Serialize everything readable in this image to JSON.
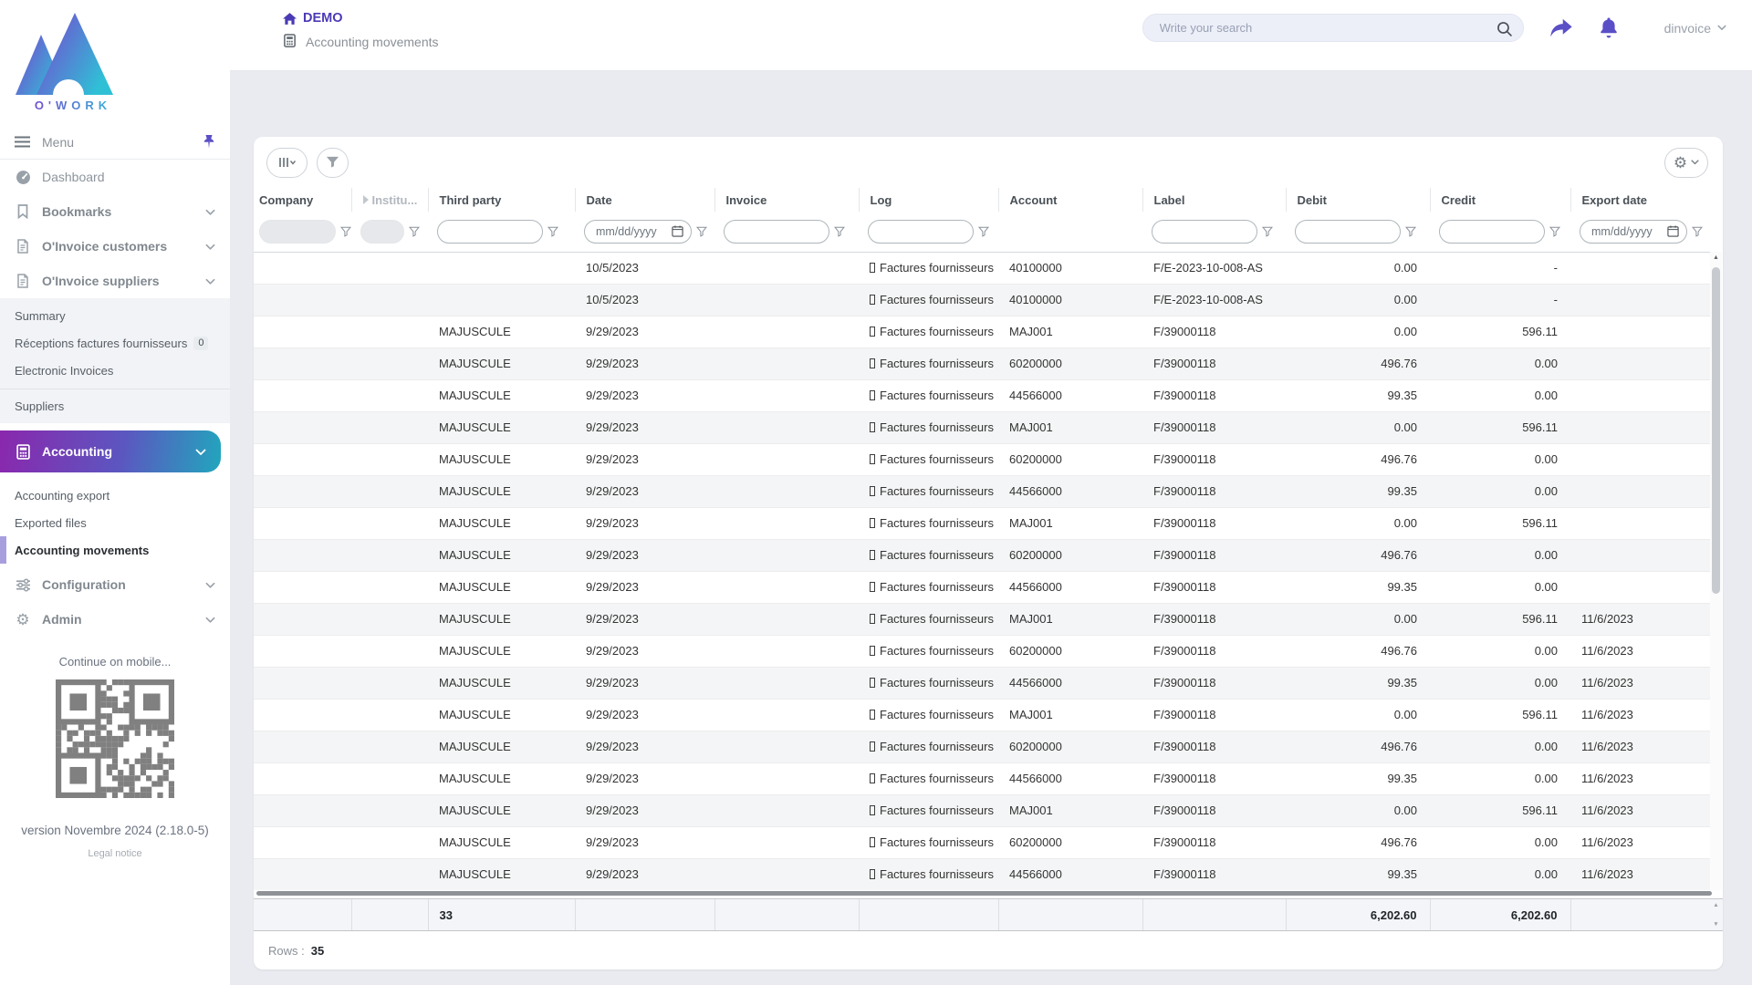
{
  "brand": {
    "wordmark": "O'WORK"
  },
  "header": {
    "breadcrumb_home": "DEMO",
    "breadcrumb_page": "Accounting movements",
    "search_placeholder": "Write your search",
    "username": "dinvoice"
  },
  "sidebar": {
    "menu_label": "Menu",
    "items": [
      {
        "label": "Dashboard"
      },
      {
        "label": "Bookmarks"
      },
      {
        "label": "O'Invoice customers"
      },
      {
        "label": "O'Invoice suppliers"
      },
      {
        "label": "Accounting"
      },
      {
        "label": "Configuration"
      },
      {
        "label": "Admin"
      }
    ],
    "suppliers_submenu": {
      "summary": "Summary",
      "receptions": "Réceptions factures fournisseurs",
      "receptions_badge": "0",
      "electronic_invoices": "Electronic Invoices",
      "suppliers": "Suppliers"
    },
    "accounting_submenu": {
      "accounting_export": "Accounting export",
      "exported_files": "Exported files",
      "accounting_movements": "Accounting movements"
    },
    "mobile_hint": "Continue on mobile...",
    "version": "version Novembre 2024 (2.18.0-5)",
    "legal_notice": "Legal notice"
  },
  "table": {
    "columns": [
      "Company",
      "Institu...",
      "Third party",
      "Date",
      "Invoice",
      "Log",
      "Account",
      "Label",
      "Debit",
      "Credit",
      "Export date"
    ],
    "date_placeholder": "mm/dd/yyyy",
    "rows": [
      {
        "company": "",
        "institution": "",
        "third_party": "",
        "date": "10/5/2023",
        "invoice": "",
        "log": "Factures fournisseurs",
        "account": "40100000",
        "label": "F/E-2023-10-008-AS",
        "debit": "0.00",
        "credit": "-",
        "export_date": ""
      },
      {
        "company": "",
        "institution": "",
        "third_party": "",
        "date": "10/5/2023",
        "invoice": "",
        "log": "Factures fournisseurs",
        "account": "40100000",
        "label": "F/E-2023-10-008-AS",
        "debit": "0.00",
        "credit": "-",
        "export_date": ""
      },
      {
        "company": "",
        "institution": "",
        "third_party": "MAJUSCULE",
        "date": "9/29/2023",
        "invoice": "",
        "log": "Factures fournisseurs",
        "account": "MAJ001",
        "label": "F/39000118",
        "debit": "0.00",
        "credit": "596.11",
        "export_date": ""
      },
      {
        "company": "",
        "institution": "",
        "third_party": "MAJUSCULE",
        "date": "9/29/2023",
        "invoice": "",
        "log": "Factures fournisseurs",
        "account": "60200000",
        "label": "F/39000118",
        "debit": "496.76",
        "credit": "0.00",
        "export_date": ""
      },
      {
        "company": "",
        "institution": "",
        "third_party": "MAJUSCULE",
        "date": "9/29/2023",
        "invoice": "",
        "log": "Factures fournisseurs",
        "account": "44566000",
        "label": "F/39000118",
        "debit": "99.35",
        "credit": "0.00",
        "export_date": ""
      },
      {
        "company": "",
        "institution": "",
        "third_party": "MAJUSCULE",
        "date": "9/29/2023",
        "invoice": "",
        "log": "Factures fournisseurs",
        "account": "MAJ001",
        "label": "F/39000118",
        "debit": "0.00",
        "credit": "596.11",
        "export_date": ""
      },
      {
        "company": "",
        "institution": "",
        "third_party": "MAJUSCULE",
        "date": "9/29/2023",
        "invoice": "",
        "log": "Factures fournisseurs",
        "account": "60200000",
        "label": "F/39000118",
        "debit": "496.76",
        "credit": "0.00",
        "export_date": ""
      },
      {
        "company": "",
        "institution": "",
        "third_party": "MAJUSCULE",
        "date": "9/29/2023",
        "invoice": "",
        "log": "Factures fournisseurs",
        "account": "44566000",
        "label": "F/39000118",
        "debit": "99.35",
        "credit": "0.00",
        "export_date": ""
      },
      {
        "company": "",
        "institution": "",
        "third_party": "MAJUSCULE",
        "date": "9/29/2023",
        "invoice": "",
        "log": "Factures fournisseurs",
        "account": "MAJ001",
        "label": "F/39000118",
        "debit": "0.00",
        "credit": "596.11",
        "export_date": ""
      },
      {
        "company": "",
        "institution": "",
        "third_party": "MAJUSCULE",
        "date": "9/29/2023",
        "invoice": "",
        "log": "Factures fournisseurs",
        "account": "60200000",
        "label": "F/39000118",
        "debit": "496.76",
        "credit": "0.00",
        "export_date": ""
      },
      {
        "company": "",
        "institution": "",
        "third_party": "MAJUSCULE",
        "date": "9/29/2023",
        "invoice": "",
        "log": "Factures fournisseurs",
        "account": "44566000",
        "label": "F/39000118",
        "debit": "99.35",
        "credit": "0.00",
        "export_date": ""
      },
      {
        "company": "",
        "institution": "",
        "third_party": "MAJUSCULE",
        "date": "9/29/2023",
        "invoice": "",
        "log": "Factures fournisseurs",
        "account": "MAJ001",
        "label": "F/39000118",
        "debit": "0.00",
        "credit": "596.11",
        "export_date": "11/6/2023"
      },
      {
        "company": "",
        "institution": "",
        "third_party": "MAJUSCULE",
        "date": "9/29/2023",
        "invoice": "",
        "log": "Factures fournisseurs",
        "account": "60200000",
        "label": "F/39000118",
        "debit": "496.76",
        "credit": "0.00",
        "export_date": "11/6/2023"
      },
      {
        "company": "",
        "institution": "",
        "third_party": "MAJUSCULE",
        "date": "9/29/2023",
        "invoice": "",
        "log": "Factures fournisseurs",
        "account": "44566000",
        "label": "F/39000118",
        "debit": "99.35",
        "credit": "0.00",
        "export_date": "11/6/2023"
      },
      {
        "company": "",
        "institution": "",
        "third_party": "MAJUSCULE",
        "date": "9/29/2023",
        "invoice": "",
        "log": "Factures fournisseurs",
        "account": "MAJ001",
        "label": "F/39000118",
        "debit": "0.00",
        "credit": "596.11",
        "export_date": "11/6/2023"
      },
      {
        "company": "",
        "institution": "",
        "third_party": "MAJUSCULE",
        "date": "9/29/2023",
        "invoice": "",
        "log": "Factures fournisseurs",
        "account": "60200000",
        "label": "F/39000118",
        "debit": "496.76",
        "credit": "0.00",
        "export_date": "11/6/2023"
      },
      {
        "company": "",
        "institution": "",
        "third_party": "MAJUSCULE",
        "date": "9/29/2023",
        "invoice": "",
        "log": "Factures fournisseurs",
        "account": "44566000",
        "label": "F/39000118",
        "debit": "99.35",
        "credit": "0.00",
        "export_date": "11/6/2023"
      },
      {
        "company": "",
        "institution": "",
        "third_party": "MAJUSCULE",
        "date": "9/29/2023",
        "invoice": "",
        "log": "Factures fournisseurs",
        "account": "MAJ001",
        "label": "F/39000118",
        "debit": "0.00",
        "credit": "596.11",
        "export_date": "11/6/2023"
      },
      {
        "company": "",
        "institution": "",
        "third_party": "MAJUSCULE",
        "date": "9/29/2023",
        "invoice": "",
        "log": "Factures fournisseurs",
        "account": "60200000",
        "label": "F/39000118",
        "debit": "496.76",
        "credit": "0.00",
        "export_date": "11/6/2023"
      },
      {
        "company": "",
        "institution": "",
        "third_party": "MAJUSCULE",
        "date": "9/29/2023",
        "invoice": "",
        "log": "Factures fournisseurs",
        "account": "44566000",
        "label": "F/39000118",
        "debit": "99.35",
        "credit": "0.00",
        "export_date": "11/6/2023"
      }
    ],
    "totals": {
      "third_party": "33",
      "debit": "6,202.60",
      "credit": "6,202.60"
    },
    "rows_label": "Rows :",
    "rows_count": "35"
  },
  "colors": {
    "accent": "#5b4fc7",
    "gradient_from": "#8a27ad",
    "gradient_to": "#21a6bd"
  }
}
